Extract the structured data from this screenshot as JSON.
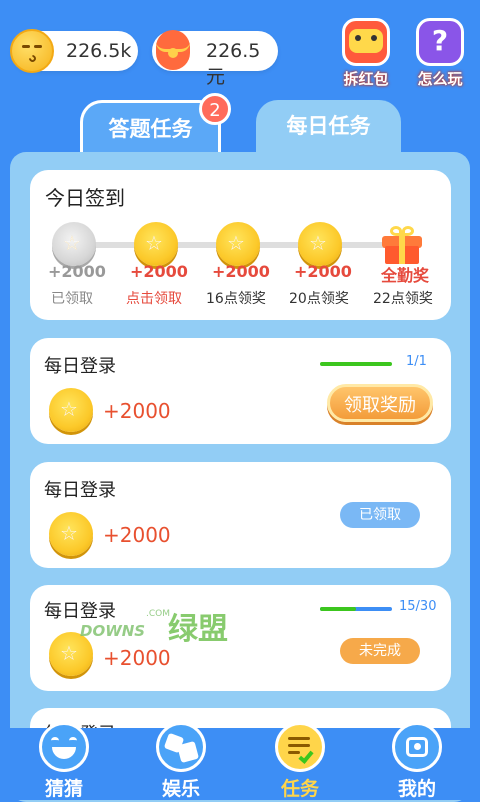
{
  "top": {
    "coins": "226.5k",
    "money": "226.5元",
    "redpack_label": "拆红包",
    "howto_label": "怎么玩",
    "howto_icon": "?"
  },
  "tabs": [
    {
      "label": "答题任务",
      "badge": "2"
    },
    {
      "label": "每日任务"
    }
  ],
  "checkin": {
    "title": "今日签到",
    "steps": [
      {
        "amount": "+2000",
        "caption": "已领取"
      },
      {
        "amount": "+2000",
        "caption": "点击领取"
      },
      {
        "amount": "+2000",
        "caption": "16点领奖"
      },
      {
        "amount": "+2000",
        "caption": "20点领奖"
      },
      {
        "amount": "全勤奖",
        "caption": "22点领奖"
      }
    ]
  },
  "tasks": [
    {
      "title": "每日登录",
      "reward": "+2000",
      "progress_text": "1/1",
      "progress": 1.0,
      "button": "领取奖励"
    },
    {
      "title": "每日登录",
      "reward": "+2000",
      "button": "已领取"
    },
    {
      "title": "每日登录",
      "reward": "+2000",
      "progress_text": "15/30",
      "progress": 0.5,
      "button": "未完成"
    },
    {
      "title": "每日登录"
    }
  ],
  "watermark": {
    "brand": "DOWNS",
    "cn": "绿盟",
    "dot": ".COM"
  },
  "nav": [
    {
      "label": "猜猜"
    },
    {
      "label": "娱乐"
    },
    {
      "label": "任务"
    },
    {
      "label": "我的"
    }
  ],
  "colors": {
    "background": "#3d8ef5",
    "panel": "#92cdf5",
    "accent_red": "#e64a3d",
    "progress_green": "#3cc61e",
    "progress_blue": "#3d8ef5",
    "button_orange": "#f6a94a",
    "button_blue": "#7ab8f5",
    "nav_active": "#ffd54a"
  }
}
